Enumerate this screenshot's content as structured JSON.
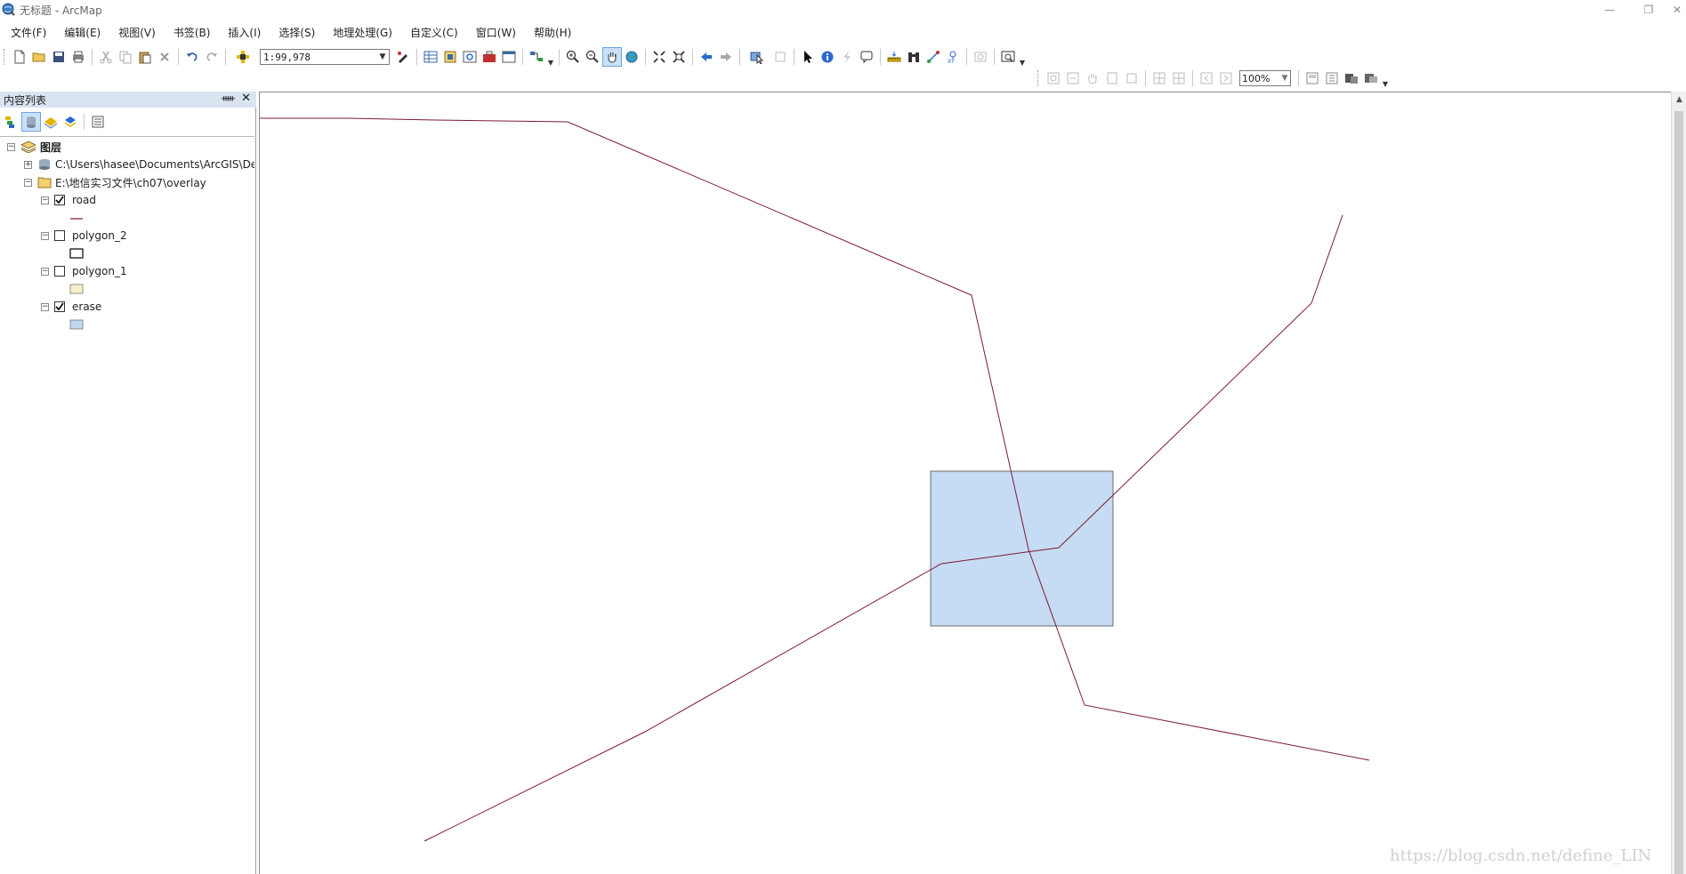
{
  "window": {
    "title": "无标题 - ArcMap",
    "minimize": "—",
    "restore": "❐",
    "close": "✕"
  },
  "menu": [
    "文件(F)",
    "编辑(E)",
    "视图(V)",
    "书签(B)",
    "插入(I)",
    "选择(S)",
    "地理处理(G)",
    "自定义(C)",
    "窗口(W)",
    "帮助(H)"
  ],
  "toolbar": {
    "scale": "1:99,978",
    "zoom": "100%"
  },
  "toc": {
    "title": "内容列表",
    "pin": "ᚔ",
    "close": "✕",
    "root": "图层",
    "folders": [
      {
        "path": "C:\\Users\\hasee\\Documents\\ArcGIS\\De",
        "expanded": false
      },
      {
        "path": "E:\\地信实习文件\\ch07\\overlay",
        "expanded": true
      }
    ],
    "layers": [
      {
        "name": "road",
        "checked": true,
        "symbol": "line",
        "color": "#7b1b2e"
      },
      {
        "name": "polygon_2",
        "checked": false,
        "symbol": "hollow-polygon",
        "color": "#000000"
      },
      {
        "name": "polygon_1",
        "checked": false,
        "symbol": "polygon",
        "color": "#f5f0c8"
      },
      {
        "name": "erase",
        "checked": true,
        "symbol": "polygon",
        "color": "#bfd7f3"
      }
    ]
  },
  "colors": {
    "road": "#7b1b2e",
    "erase_fill": "#c6dbf4",
    "erase_stroke": "#4d4d4d",
    "toc_header": "#d9e4f1"
  },
  "watermark": "https://blog.csdn.net/define_LIN"
}
